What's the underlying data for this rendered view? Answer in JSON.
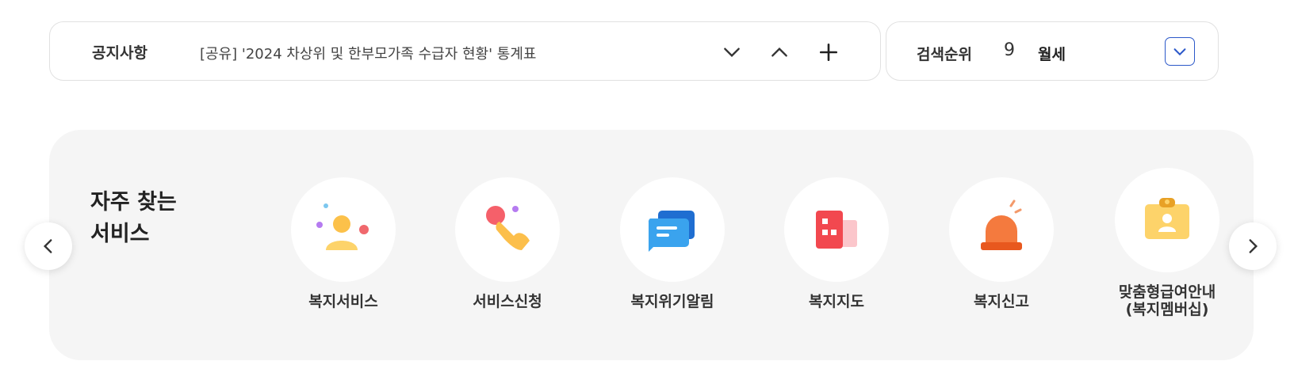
{
  "notice": {
    "title": "공지사항",
    "text": "[공유] '2024 차상위 및 한부모가족 수급자 현황' 통계표",
    "buttons": {
      "down": "chevron-down-icon",
      "up": "chevron-up-icon",
      "more": "plus-icon"
    }
  },
  "rank": {
    "title": "검색순위",
    "number": "9",
    "keyword": "월세"
  },
  "services": {
    "title_line1": "자주 찾는",
    "title_line2": "서비스",
    "items": [
      {
        "label": "복지서비스",
        "icon": "people-icon"
      },
      {
        "label": "서비스신청",
        "icon": "tap-hand-icon"
      },
      {
        "label": "복지위기알림",
        "icon": "chat-bubble-icon"
      },
      {
        "label": "복지지도",
        "icon": "building-icon"
      },
      {
        "label": "복지신고",
        "icon": "siren-icon"
      },
      {
        "label": "맞춤형급여안내\n(복지멤버십)",
        "icon": "id-card-icon"
      }
    ]
  },
  "colors": {
    "accent": "#2b58c9",
    "panel_bg": "#f5f5f5",
    "border": "#e1e1e1"
  }
}
